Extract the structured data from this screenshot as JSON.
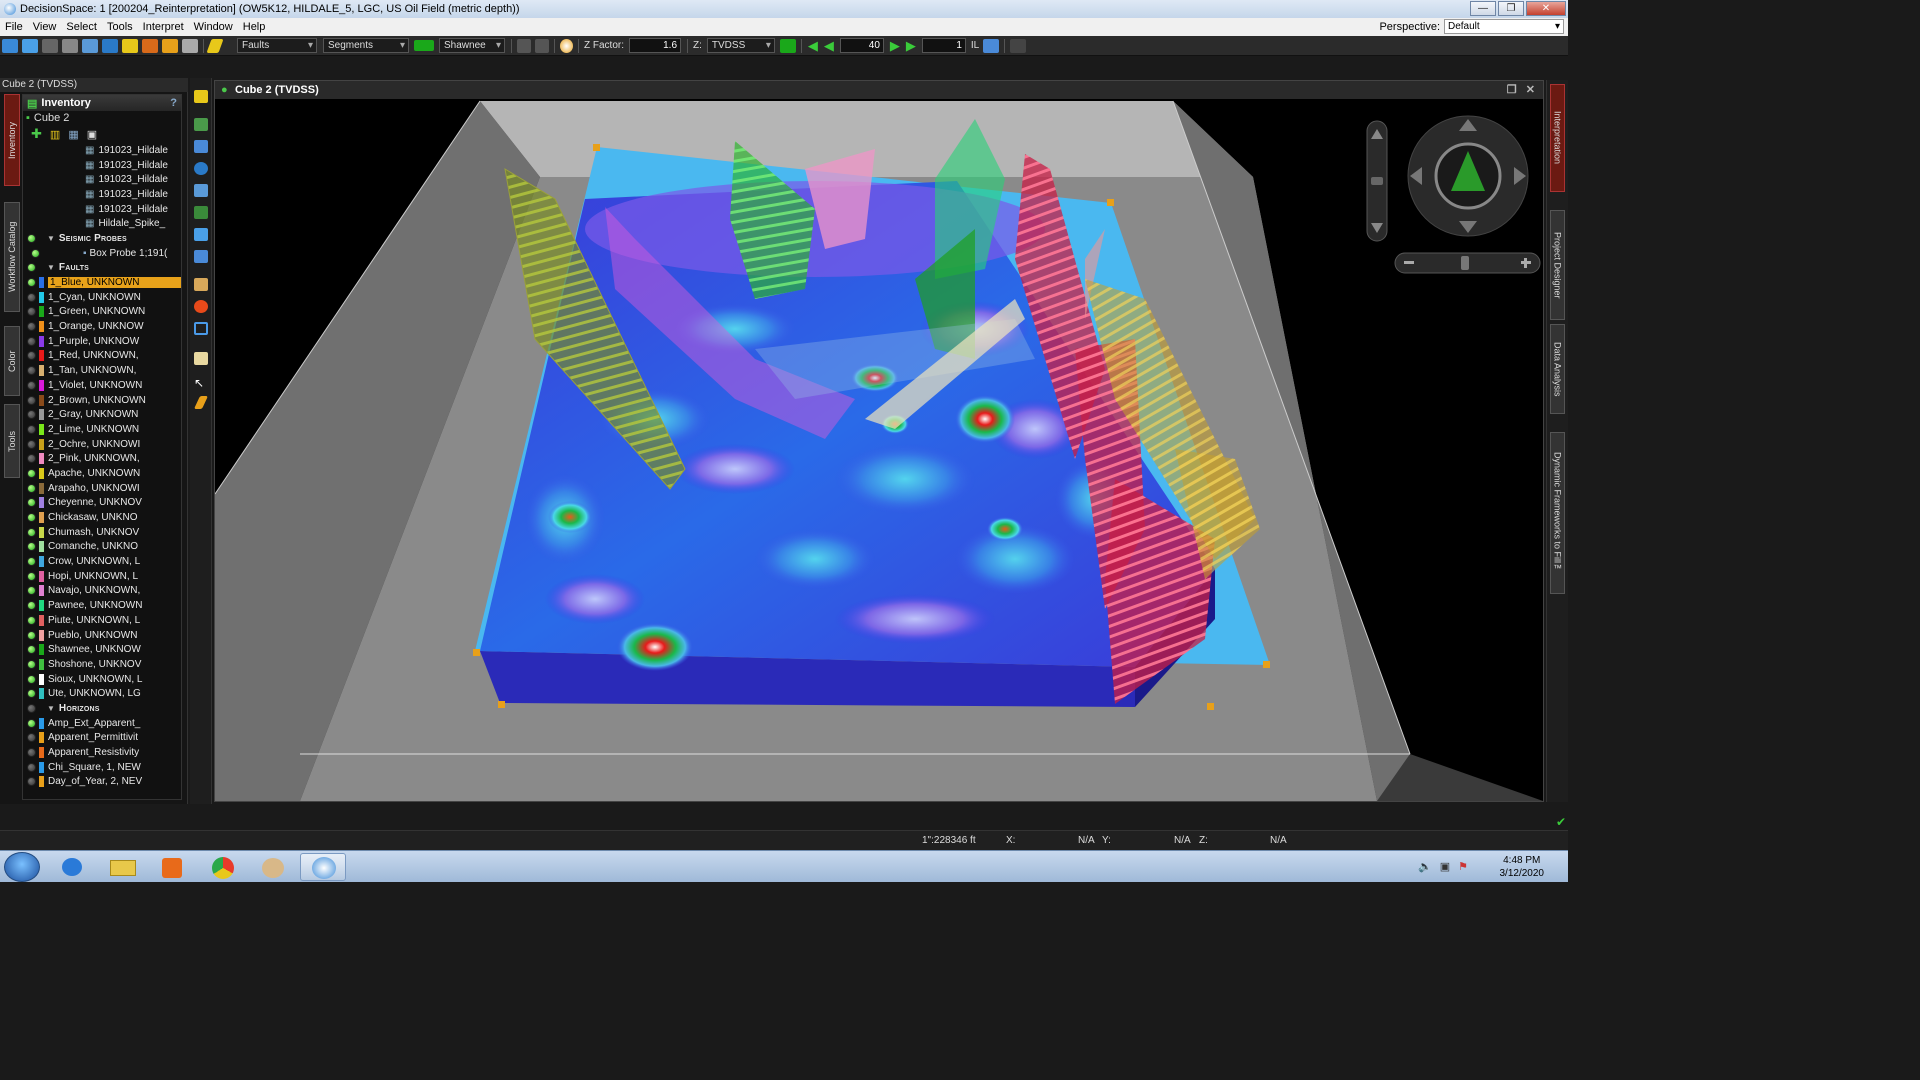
{
  "window": {
    "title": "DecisionSpace: 1 [200204_Reinterpretation] (OW5K12, HILDALE_5, LGC, US Oil Field (metric depth))",
    "minimize": "—",
    "restore": "❐",
    "close": "✕"
  },
  "menu": {
    "items": [
      "File",
      "View",
      "Select",
      "Tools",
      "Interpret",
      "Window",
      "Help"
    ],
    "perspective_label": "Perspective:",
    "perspective_value": "Default"
  },
  "toolbar": {
    "faults_select": "Faults",
    "segments_select": "Segments",
    "fault_name_select": "Shawnee",
    "zfactor_label": "Z Factor:",
    "zfactor_value": "1.6",
    "z_label": "Z:",
    "z_domain_select": "TVDSS",
    "slice_value": "40",
    "step_value": "1",
    "il_label": "IL"
  },
  "left_panel": {
    "title": "Cube 2 (TVDSS)",
    "tabs": [
      "Inventory",
      "Workflow Catalog",
      "Color",
      "Tools"
    ],
    "inventory_header": "Inventory",
    "root_item": "Cube 2",
    "seismic_items": [
      "191023_Hildale",
      "191023_Hildale",
      "191023_Hildale",
      "191023_Hildale",
      "191023_Hildale",
      "Hildale_Spike_"
    ],
    "section_probes": "Seismic Probes",
    "probe_item": "Box Probe 1;191(",
    "section_faults": "Faults",
    "faults": [
      {
        "label": "1_Blue, UNKNOWN",
        "color": "#2a6fe8",
        "on": true,
        "selected": true
      },
      {
        "label": "1_Cyan, UNKNOWN",
        "color": "#22c8e8",
        "on": false
      },
      {
        "label": "1_Green, UNKNOWN",
        "color": "#1aa81a",
        "on": false
      },
      {
        "label": "1_Orange, UNKNOW",
        "color": "#f0901a",
        "on": false
      },
      {
        "label": "1_Purple, UNKNOW",
        "color": "#8a3ae8",
        "on": false
      },
      {
        "label": "1_Red, UNKNOWN,",
        "color": "#e81a1a",
        "on": false
      },
      {
        "label": "1_Tan, UNKNOWN,",
        "color": "#d8b070",
        "on": false
      },
      {
        "label": "1_Violet, UNKNOWN",
        "color": "#d81ad8",
        "on": false
      },
      {
        "label": "2_Brown, UNKNOWN",
        "color": "#8a4a1a",
        "on": false
      },
      {
        "label": "2_Gray, UNKNOWN",
        "color": "#999999",
        "on": false
      },
      {
        "label": "2_Lime, UNKNOWN",
        "color": "#7ae81a",
        "on": false
      },
      {
        "label": "2_Ochre, UNKNOWI",
        "color": "#c8a01a",
        "on": false
      },
      {
        "label": "2_Pink, UNKNOWN,",
        "color": "#f08ac0",
        "on": false
      },
      {
        "label": "Apache, UNKNOWN",
        "color": "#d8c81a",
        "on": true
      },
      {
        "label": "Arapaho, UNKNOWI",
        "color": "#8a6a3a",
        "on": true
      },
      {
        "label": "Cheyenne, UNKNOV",
        "color": "#a080e0",
        "on": true
      },
      {
        "label": "Chickasaw, UNKNO",
        "color": "#e0a050",
        "on": true
      },
      {
        "label": "Chumash, UNKNOV",
        "color": "#c8d84a",
        "on": true
      },
      {
        "label": "Comanche, UNKNO",
        "color": "#a0e0a0",
        "on": true
      },
      {
        "label": "Crow, UNKNOWN, L",
        "color": "#40a8e0",
        "on": true
      },
      {
        "label": "Hopi, UNKNOWN, L",
        "color": "#e060a0",
        "on": true
      },
      {
        "label": "Navajo, UNKNOWN,",
        "color": "#e080d0",
        "on": true
      },
      {
        "label": "Pawnee, UNKNOWN",
        "color": "#20d880",
        "on": true
      },
      {
        "label": "Piute, UNKNOWN, L",
        "color": "#e06060",
        "on": true
      },
      {
        "label": "Pueblo, UNKNOWN",
        "color": "#f0a0a0",
        "on": true
      },
      {
        "label": "Shawnee, UNKNOW",
        "color": "#1aa81a",
        "on": true
      },
      {
        "label": "Shoshone, UNKNOV",
        "color": "#40c040",
        "on": true
      },
      {
        "label": "Sioux, UNKNOWN, L",
        "color": "#ffffff",
        "on": true
      },
      {
        "label": "Ute, UNKNOWN, LG",
        "color": "#30c0c0",
        "on": true
      }
    ],
    "section_horizons": "Horizons",
    "horizons": [
      {
        "label": "Amp_Ext_Apparent_",
        "color": "#2a9ae8",
        "on": true
      },
      {
        "label": "Apparent_Permittivit",
        "color": "#e8a01a",
        "on": false
      },
      {
        "label": "Apparent_Resistivity",
        "color": "#e86a1a",
        "on": false
      },
      {
        "label": "Chi_Square, 1, NEW",
        "color": "#2a9ae8",
        "on": false
      },
      {
        "label": "Day_of_Year, 2, NEV",
        "color": "#e8a01a",
        "on": false
      }
    ]
  },
  "viewer": {
    "title": "Cube 2 (TVDSS)"
  },
  "right_tabs": [
    "Interpretation",
    "Project Designer",
    "Data Analysis",
    "Dynamic Frameworks to Fill™"
  ],
  "statusbar": {
    "scale": "1\":228346 ft",
    "x_label": "X:",
    "x_value": "N/A",
    "y_label": "Y:",
    "y_value": "N/A",
    "z_label": "Z:",
    "z_value": "N/A"
  },
  "taskbar": {
    "time": "4:48 PM",
    "date": "3/12/2020"
  }
}
